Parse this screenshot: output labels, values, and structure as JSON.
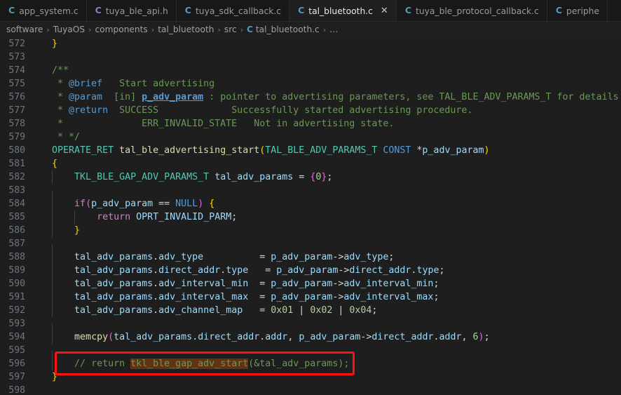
{
  "window": {
    "app": "vscode-editor",
    "background": "#1e1e1e",
    "tabbar_background": "#181818",
    "active_tab_background": "#1f1f1f"
  },
  "tabs": [
    {
      "label": "app_system.c",
      "icon": "c-file-icon",
      "icon_kind": "c",
      "active": false,
      "closable": false
    },
    {
      "label": "tuya_ble_api.h",
      "icon": "h-file-icon",
      "icon_kind": "h",
      "active": false,
      "closable": false
    },
    {
      "label": "tuya_sdk_callback.c",
      "icon": "c-file-icon",
      "icon_kind": "c",
      "active": false,
      "closable": false
    },
    {
      "label": "tal_bluetooth.c",
      "icon": "c-file-icon",
      "icon_kind": "c",
      "active": true,
      "closable": true,
      "close_label": "✕"
    },
    {
      "label": "tuya_ble_protocol_callback.c",
      "icon": "c-file-icon",
      "icon_kind": "c",
      "active": false,
      "closable": false
    },
    {
      "label": "periphe",
      "icon": "c-file-icon",
      "icon_kind": "c",
      "active": false,
      "closable": false
    }
  ],
  "breadcrumb": {
    "separator": "›",
    "items": [
      {
        "label": "software",
        "icon": null
      },
      {
        "label": "TuyaOS",
        "icon": null
      },
      {
        "label": "components",
        "icon": null
      },
      {
        "label": "tal_bluetooth",
        "icon": null
      },
      {
        "label": "src",
        "icon": null
      },
      {
        "label": "tal_bluetooth.c",
        "icon": "c-file-icon"
      },
      {
        "label": "…",
        "icon": null
      }
    ]
  },
  "annotation": {
    "type": "red-rectangle-highlight",
    "color": "#ff1111",
    "target_line": 596
  },
  "editor": {
    "first_line": 572,
    "search_highlight_color": "#613214",
    "search_highlight_term": "tkl_ble_gap_adv_start",
    "lines": [
      {
        "no": 572,
        "guides": 0,
        "tokens": [
          {
            "t": "  ",
            "c": "t-plain"
          },
          {
            "t": "}",
            "c": "t-br-y"
          }
        ]
      },
      {
        "no": 573,
        "guides": 0,
        "tokens": []
      },
      {
        "no": 574,
        "guides": 0,
        "tokens": [
          {
            "t": "  /**",
            "c": "t-comment"
          }
        ]
      },
      {
        "no": 575,
        "guides": 0,
        "tokens": [
          {
            "t": "   * ",
            "c": "t-comment"
          },
          {
            "t": "@brief",
            "c": "t-doctag"
          },
          {
            "t": "   Start advertising",
            "c": "t-comment"
          }
        ]
      },
      {
        "no": 576,
        "guides": 0,
        "tokens": [
          {
            "t": "   * ",
            "c": "t-comment"
          },
          {
            "t": "@param",
            "c": "t-doctag"
          },
          {
            "t": "  [in] ",
            "c": "t-comment"
          },
          {
            "t": "p_adv_param",
            "c": "t-docparam"
          },
          {
            "t": " : pointer to advertising parameters, see TAL_BLE_ADV_PARAMS_T for details",
            "c": "t-comment"
          }
        ]
      },
      {
        "no": 577,
        "guides": 0,
        "tokens": [
          {
            "t": "   * ",
            "c": "t-comment"
          },
          {
            "t": "@return",
            "c": "t-doctag"
          },
          {
            "t": "  SUCCESS             Successfully started advertising procedure.",
            "c": "t-comment"
          }
        ]
      },
      {
        "no": 578,
        "guides": 0,
        "tokens": [
          {
            "t": "   *              ERR_INVALID_STATE   Not in advertising state.",
            "c": "t-comment"
          }
        ]
      },
      {
        "no": 579,
        "guides": 0,
        "tokens": [
          {
            "t": "   * */",
            "c": "t-comment"
          }
        ]
      },
      {
        "no": 580,
        "guides": 0,
        "tokens": [
          {
            "t": "  ",
            "c": "t-plain"
          },
          {
            "t": "OPERATE_RET",
            "c": "t-type"
          },
          {
            "t": " ",
            "c": "t-plain"
          },
          {
            "t": "tal_ble_advertising_start",
            "c": "t-func"
          },
          {
            "t": "(",
            "c": "t-br-y"
          },
          {
            "t": "TAL_BLE_ADV_PARAMS_T",
            "c": "t-type"
          },
          {
            "t": " ",
            "c": "t-plain"
          },
          {
            "t": "CONST",
            "c": "t-ctl"
          },
          {
            "t": " *",
            "c": "t-plain"
          },
          {
            "t": "p_adv_param",
            "c": "t-var"
          },
          {
            "t": ")",
            "c": "t-br-y"
          }
        ]
      },
      {
        "no": 581,
        "guides": 0,
        "tokens": [
          {
            "t": "  ",
            "c": "t-plain"
          },
          {
            "t": "{",
            "c": "t-br-y"
          }
        ]
      },
      {
        "no": 582,
        "guides": 1,
        "tokens": [
          {
            "t": "      ",
            "c": "t-plain"
          },
          {
            "t": "TKL_BLE_GAP_ADV_PARAMS_T",
            "c": "t-type"
          },
          {
            "t": " ",
            "c": "t-plain"
          },
          {
            "t": "tal_adv_params",
            "c": "t-var"
          },
          {
            "t": " = ",
            "c": "t-plain"
          },
          {
            "t": "{",
            "c": "t-br-p"
          },
          {
            "t": "0",
            "c": "t-num"
          },
          {
            "t": "}",
            "c": "t-br-p"
          },
          {
            "t": ";",
            "c": "t-plain"
          }
        ]
      },
      {
        "no": 583,
        "guides": 1,
        "tokens": []
      },
      {
        "no": 584,
        "guides": 1,
        "tokens": [
          {
            "t": "      ",
            "c": "t-plain"
          },
          {
            "t": "if",
            "c": "t-kw"
          },
          {
            "t": "(",
            "c": "t-br-p"
          },
          {
            "t": "p_adv_param",
            "c": "t-var"
          },
          {
            "t": " == ",
            "c": "t-plain"
          },
          {
            "t": "NULL",
            "c": "t-ctl"
          },
          {
            "t": ")",
            "c": "t-br-p"
          },
          {
            "t": " ",
            "c": "t-plain"
          },
          {
            "t": "{",
            "c": "t-br-y"
          }
        ]
      },
      {
        "no": 585,
        "guides": 2,
        "tokens": [
          {
            "t": "          ",
            "c": "t-plain"
          },
          {
            "t": "return",
            "c": "t-kw"
          },
          {
            "t": " ",
            "c": "t-plain"
          },
          {
            "t": "OPRT_INVALID_PARM",
            "c": "t-var"
          },
          {
            "t": ";",
            "c": "t-plain"
          }
        ]
      },
      {
        "no": 586,
        "guides": 1,
        "tokens": [
          {
            "t": "      ",
            "c": "t-plain"
          },
          {
            "t": "}",
            "c": "t-br-y"
          }
        ]
      },
      {
        "no": 587,
        "guides": 1,
        "tokens": []
      },
      {
        "no": 588,
        "guides": 1,
        "tokens": [
          {
            "t": "      ",
            "c": "t-plain"
          },
          {
            "t": "tal_adv_params",
            "c": "t-var"
          },
          {
            "t": ".",
            "c": "t-plain"
          },
          {
            "t": "adv_type",
            "c": "t-var"
          },
          {
            "t": "          = ",
            "c": "t-plain"
          },
          {
            "t": "p_adv_param",
            "c": "t-var"
          },
          {
            "t": "->",
            "c": "t-plain"
          },
          {
            "t": "adv_type",
            "c": "t-var"
          },
          {
            "t": ";",
            "c": "t-plain"
          }
        ]
      },
      {
        "no": 589,
        "guides": 1,
        "tokens": [
          {
            "t": "      ",
            "c": "t-plain"
          },
          {
            "t": "tal_adv_params",
            "c": "t-var"
          },
          {
            "t": ".",
            "c": "t-plain"
          },
          {
            "t": "direct_addr",
            "c": "t-var"
          },
          {
            "t": ".",
            "c": "t-plain"
          },
          {
            "t": "type",
            "c": "t-var"
          },
          {
            "t": "   = ",
            "c": "t-plain"
          },
          {
            "t": "p_adv_param",
            "c": "t-var"
          },
          {
            "t": "->",
            "c": "t-plain"
          },
          {
            "t": "direct_addr",
            "c": "t-var"
          },
          {
            "t": ".",
            "c": "t-plain"
          },
          {
            "t": "type",
            "c": "t-var"
          },
          {
            "t": ";",
            "c": "t-plain"
          }
        ]
      },
      {
        "no": 590,
        "guides": 1,
        "tokens": [
          {
            "t": "      ",
            "c": "t-plain"
          },
          {
            "t": "tal_adv_params",
            "c": "t-var"
          },
          {
            "t": ".",
            "c": "t-plain"
          },
          {
            "t": "adv_interval_min",
            "c": "t-var"
          },
          {
            "t": "  = ",
            "c": "t-plain"
          },
          {
            "t": "p_adv_param",
            "c": "t-var"
          },
          {
            "t": "->",
            "c": "t-plain"
          },
          {
            "t": "adv_interval_min",
            "c": "t-var"
          },
          {
            "t": ";",
            "c": "t-plain"
          }
        ]
      },
      {
        "no": 591,
        "guides": 1,
        "tokens": [
          {
            "t": "      ",
            "c": "t-plain"
          },
          {
            "t": "tal_adv_params",
            "c": "t-var"
          },
          {
            "t": ".",
            "c": "t-plain"
          },
          {
            "t": "adv_interval_max",
            "c": "t-var"
          },
          {
            "t": "  = ",
            "c": "t-plain"
          },
          {
            "t": "p_adv_param",
            "c": "t-var"
          },
          {
            "t": "->",
            "c": "t-plain"
          },
          {
            "t": "adv_interval_max",
            "c": "t-var"
          },
          {
            "t": ";",
            "c": "t-plain"
          }
        ]
      },
      {
        "no": 592,
        "guides": 1,
        "tokens": [
          {
            "t": "      ",
            "c": "t-plain"
          },
          {
            "t": "tal_adv_params",
            "c": "t-var"
          },
          {
            "t": ".",
            "c": "t-plain"
          },
          {
            "t": "adv_channel_map",
            "c": "t-var"
          },
          {
            "t": "   = ",
            "c": "t-plain"
          },
          {
            "t": "0x01",
            "c": "t-num"
          },
          {
            "t": " | ",
            "c": "t-plain"
          },
          {
            "t": "0x02",
            "c": "t-num"
          },
          {
            "t": " | ",
            "c": "t-plain"
          },
          {
            "t": "0x04",
            "c": "t-num"
          },
          {
            "t": ";",
            "c": "t-plain"
          }
        ]
      },
      {
        "no": 593,
        "guides": 1,
        "tokens": []
      },
      {
        "no": 594,
        "guides": 1,
        "tokens": [
          {
            "t": "      ",
            "c": "t-plain"
          },
          {
            "t": "memcpy",
            "c": "t-func"
          },
          {
            "t": "(",
            "c": "t-br-p"
          },
          {
            "t": "tal_adv_params",
            "c": "t-var"
          },
          {
            "t": ".",
            "c": "t-plain"
          },
          {
            "t": "direct_addr",
            "c": "t-var"
          },
          {
            "t": ".",
            "c": "t-plain"
          },
          {
            "t": "addr",
            "c": "t-var"
          },
          {
            "t": ", ",
            "c": "t-plain"
          },
          {
            "t": "p_adv_param",
            "c": "t-var"
          },
          {
            "t": "->",
            "c": "t-plain"
          },
          {
            "t": "direct_addr",
            "c": "t-var"
          },
          {
            "t": ".",
            "c": "t-plain"
          },
          {
            "t": "addr",
            "c": "t-var"
          },
          {
            "t": ", ",
            "c": "t-plain"
          },
          {
            "t": "6",
            "c": "t-num"
          },
          {
            "t": ")",
            "c": "t-br-p"
          },
          {
            "t": ";",
            "c": "t-plain"
          }
        ]
      },
      {
        "no": 595,
        "guides": 1,
        "tokens": []
      },
      {
        "no": 596,
        "guides": 1,
        "tokens": [
          {
            "t": "      ",
            "c": "t-plain"
          },
          {
            "t": "// return ",
            "c": "t-comment"
          },
          {
            "t": "tkl_ble_gap_adv_start",
            "c": "t-comment t-hl"
          },
          {
            "t": "(&tal_adv_params);",
            "c": "t-comment"
          }
        ]
      },
      {
        "no": 597,
        "guides": 0,
        "tokens": [
          {
            "t": "  ",
            "c": "t-plain"
          },
          {
            "t": "}",
            "c": "t-br-y"
          }
        ]
      },
      {
        "no": 598,
        "guides": 0,
        "tokens": []
      }
    ]
  }
}
